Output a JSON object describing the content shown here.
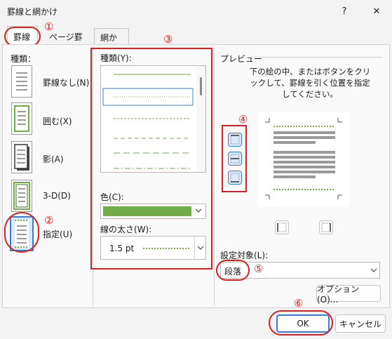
{
  "window": {
    "title": "罫線と網かけ",
    "help_label": "?",
    "close_label": "✕"
  },
  "tabs": [
    {
      "label": "罫線",
      "active": true
    },
    {
      "label": "ページ罫線",
      "active": false
    },
    {
      "label": "網かけ",
      "active": false
    }
  ],
  "settings": {
    "heading": "種類：",
    "items": [
      {
        "label": "罫線なし(N)",
        "icon": "border-none-icon"
      },
      {
        "label": "囲む(X)",
        "icon": "border-box-icon"
      },
      {
        "label": "影(A)",
        "icon": "border-shadow-icon"
      },
      {
        "label": "3-D(D)",
        "icon": "border-3d-icon"
      },
      {
        "label": "指定(U)",
        "icon": "border-custom-icon",
        "selected": true
      }
    ]
  },
  "style": {
    "heading": "種類(Y):",
    "line_styles": [
      "solid",
      "dotted",
      "dashed-small",
      "dashed-medium",
      "dashed-large",
      "dash-dot"
    ],
    "selected_index": 1
  },
  "color": {
    "label": "色(C):",
    "value_hex": "#70ad47"
  },
  "width": {
    "label": "線の太さ(W):",
    "value": "1.5 pt"
  },
  "preview": {
    "heading": "プレビュー",
    "instruction": "下の絵の中、またはボタンをクリックして、罫線を引く位置を指定してください。"
  },
  "apply_to": {
    "label": "設定対象(L):",
    "value": "段落"
  },
  "buttons": {
    "options": "オプション(O)...",
    "ok": "OK",
    "cancel": "キャンセル"
  },
  "annotations": [
    "①",
    "②",
    "③",
    "④",
    "⑤",
    "⑥"
  ],
  "colors": {
    "accent_green": "#70ad47",
    "annotation_red": "#d7201f",
    "selection_blue": "#3b7bd6"
  }
}
